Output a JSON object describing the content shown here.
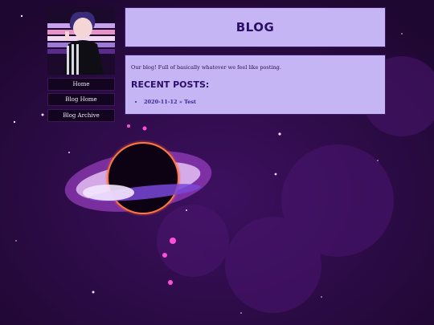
{
  "header": {
    "title": "BLOG"
  },
  "nav": {
    "home": "Home",
    "blog_home": "Blog Home",
    "blog_archive": "Blog Archive"
  },
  "content": {
    "intro": "Our blog! Full of basically whatever we feel like posting.",
    "recent_heading": "RECENT POSTS:",
    "posts": [
      {
        "link": "2020-11-12 » Test"
      }
    ]
  },
  "colors": {
    "page_bg": "#2a0a3e",
    "panel_bg": "#c5b5f5",
    "heading_text": "#2c0e67",
    "link_text": "#3f2496",
    "nav_bg": "#13051f"
  }
}
